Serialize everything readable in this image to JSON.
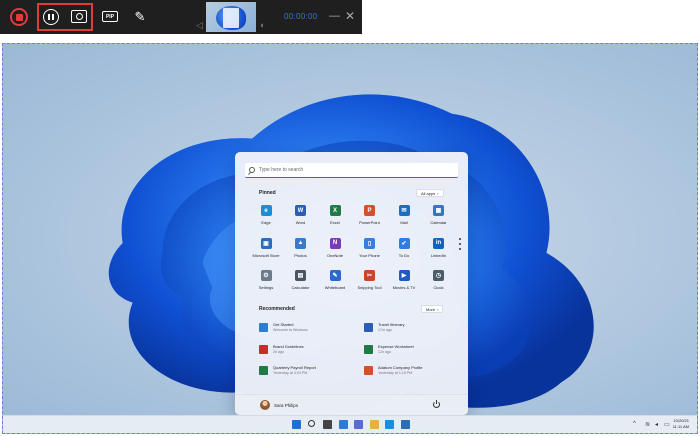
{
  "toolbar": {
    "timer": "00:00:00",
    "pip_label": "PIP",
    "icons": [
      "record-stop-icon",
      "pause-icon",
      "camera-icon",
      "pip-icon",
      "pen-icon",
      "volume-icon",
      "microphone-icon",
      "minimize-icon",
      "close-icon"
    ],
    "accent": "#e23b3b",
    "timer_color": "#3d6fe0"
  },
  "start_menu": {
    "search_placeholder": "Type here to search",
    "pinned_title": "Pinned",
    "all_apps_label": "All apps",
    "pinned": [
      {
        "label": "Edge",
        "color": "#1a8fd6",
        "glyph": "e"
      },
      {
        "label": "Word",
        "color": "#2b5cb8",
        "glyph": "W"
      },
      {
        "label": "Excel",
        "color": "#1f7a45",
        "glyph": "X"
      },
      {
        "label": "PowerPoint",
        "color": "#d2502b",
        "glyph": "P"
      },
      {
        "label": "Mail",
        "color": "#1b6ec2",
        "glyph": "✉"
      },
      {
        "label": "Calendar",
        "color": "#3b73c9",
        "glyph": "▦"
      },
      {
        "label": "Microsoft Store",
        "color": "#2d6db8",
        "glyph": "▣"
      },
      {
        "label": "Photos",
        "color": "#3a7ac8",
        "glyph": "▲"
      },
      {
        "label": "OneNote",
        "color": "#7b3bb8",
        "glyph": "N"
      },
      {
        "label": "Your Phone",
        "color": "#3b7ddd",
        "glyph": "▯"
      },
      {
        "label": "To Do",
        "color": "#2f7de1",
        "glyph": "✔"
      },
      {
        "label": "LinkedIn",
        "color": "#0a66c2",
        "glyph": "in"
      },
      {
        "label": "Settings",
        "color": "#6b7a8c",
        "glyph": "⚙"
      },
      {
        "label": "Calculator",
        "color": "#4a5563",
        "glyph": "▤"
      },
      {
        "label": "Whiteboard",
        "color": "#2b6ac9",
        "glyph": "✎"
      },
      {
        "label": "Snipping Tool",
        "color": "#c8452b",
        "glyph": "✂"
      },
      {
        "label": "Movies & TV",
        "color": "#2459c4",
        "glyph": "▶"
      },
      {
        "label": "Clock",
        "color": "#4e5b6b",
        "glyph": "◷"
      }
    ],
    "recommended_title": "Recommended",
    "more_label": "More",
    "recommended": [
      {
        "name": "Get Started",
        "sub": "Welcome to Windows",
        "color": "#2a7fd4"
      },
      {
        "name": "Travel Itinerary",
        "sub": "17m ago",
        "color": "#2b5cb8"
      },
      {
        "name": "Brand Guidelines",
        "sub": "2h ago",
        "color": "#c92b2b"
      },
      {
        "name": "Expense Worksheet",
        "sub": "12h ago",
        "color": "#1f7a45"
      },
      {
        "name": "Quarterly Payroll Report",
        "sub": "Yesterday at 4:24 PM",
        "color": "#1f7a45"
      },
      {
        "name": "Adatum Company Profile",
        "sub": "Yesterday at 1:15 PM",
        "color": "#d2502b"
      }
    ],
    "user_name": "Sara Philips"
  },
  "taskbar": {
    "icons": [
      {
        "name": "start-icon",
        "color": "#1b6fd6"
      },
      {
        "name": "search-icon",
        "color": "#333333"
      },
      {
        "name": "task-view-icon",
        "color": "#444444"
      },
      {
        "name": "widgets-icon",
        "color": "#2d7ad8"
      },
      {
        "name": "chat-icon",
        "color": "#5a6bd6"
      },
      {
        "name": "file-explorer-icon",
        "color": "#e8b23a"
      },
      {
        "name": "edge-icon",
        "color": "#1a8fd6"
      },
      {
        "name": "store-icon",
        "color": "#2d6db8"
      }
    ],
    "clock_time": "10/20/21",
    "clock_date": "11:11 AM"
  }
}
